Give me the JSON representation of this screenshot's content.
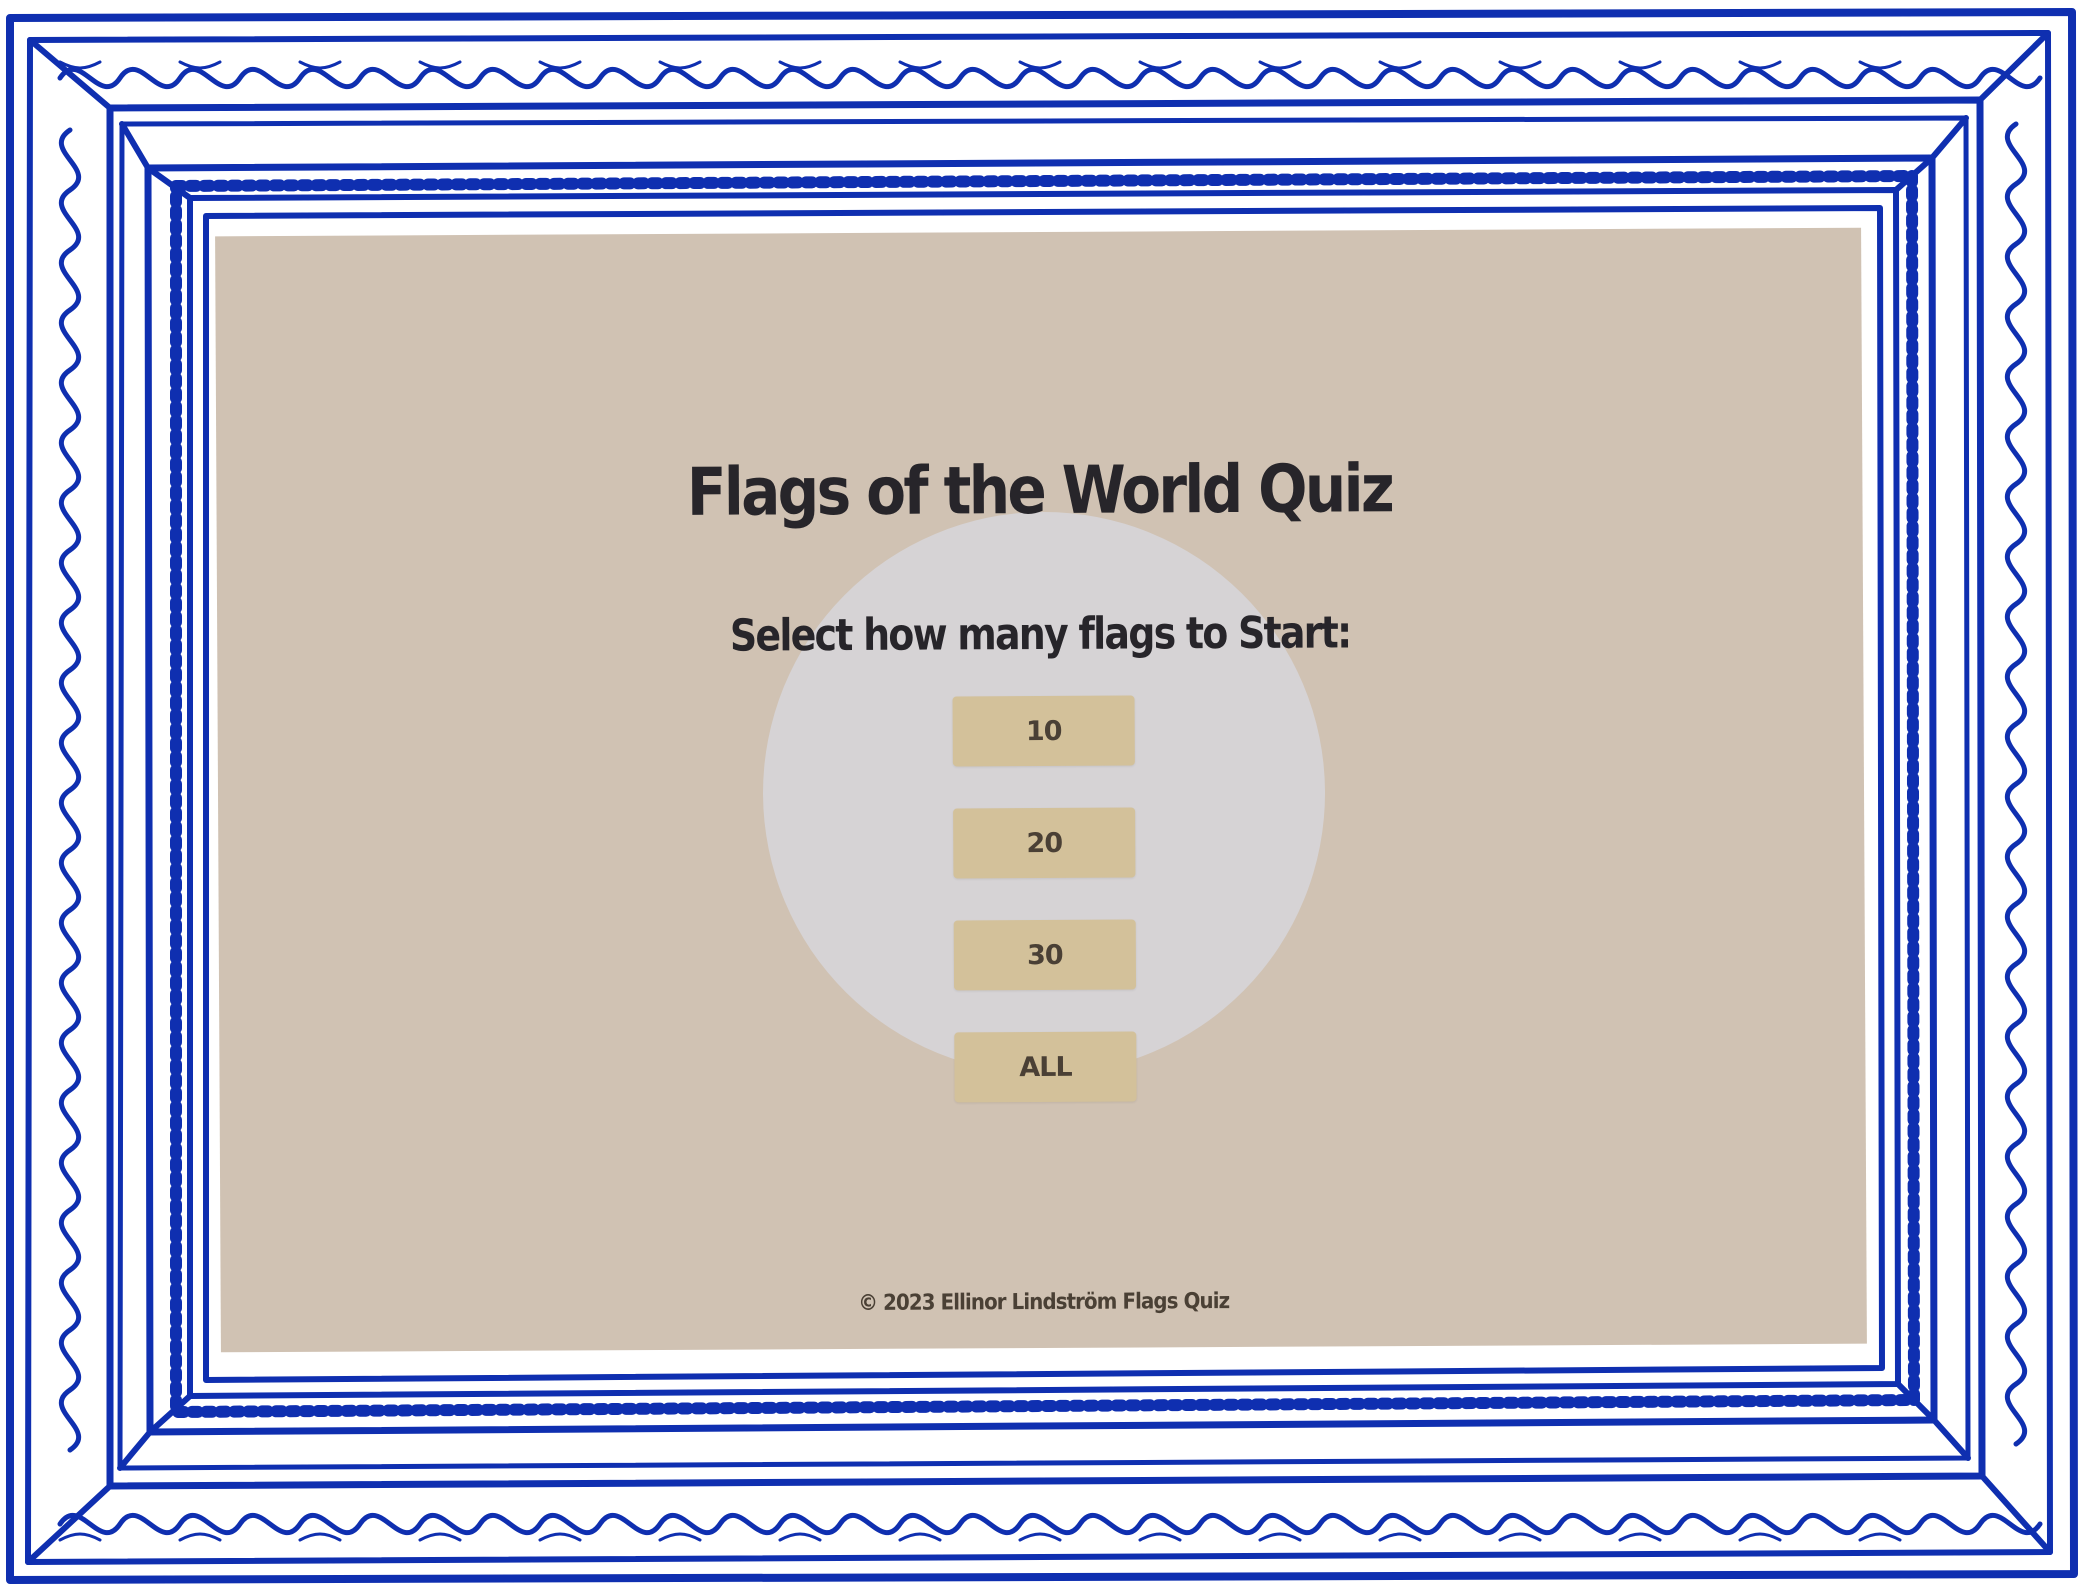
{
  "page": {
    "title": "Flags of the World Quiz",
    "subtitle": "Select how many flags to Start:"
  },
  "options": [
    {
      "label": "10"
    },
    {
      "label": "20"
    },
    {
      "label": "30"
    },
    {
      "label": "ALL"
    }
  ],
  "footer": {
    "text": "© 2023 Ellinor Lindström Flags Quiz"
  },
  "colors": {
    "frame": "#0f2fb0",
    "canvas": "#d0c2b3",
    "glow": "#d6d3d5",
    "button": "#d3c19a",
    "button_text": "#4a4035",
    "heading_text": "#27252a"
  },
  "icons": {
    "frame": "ornate-frame-icon"
  }
}
